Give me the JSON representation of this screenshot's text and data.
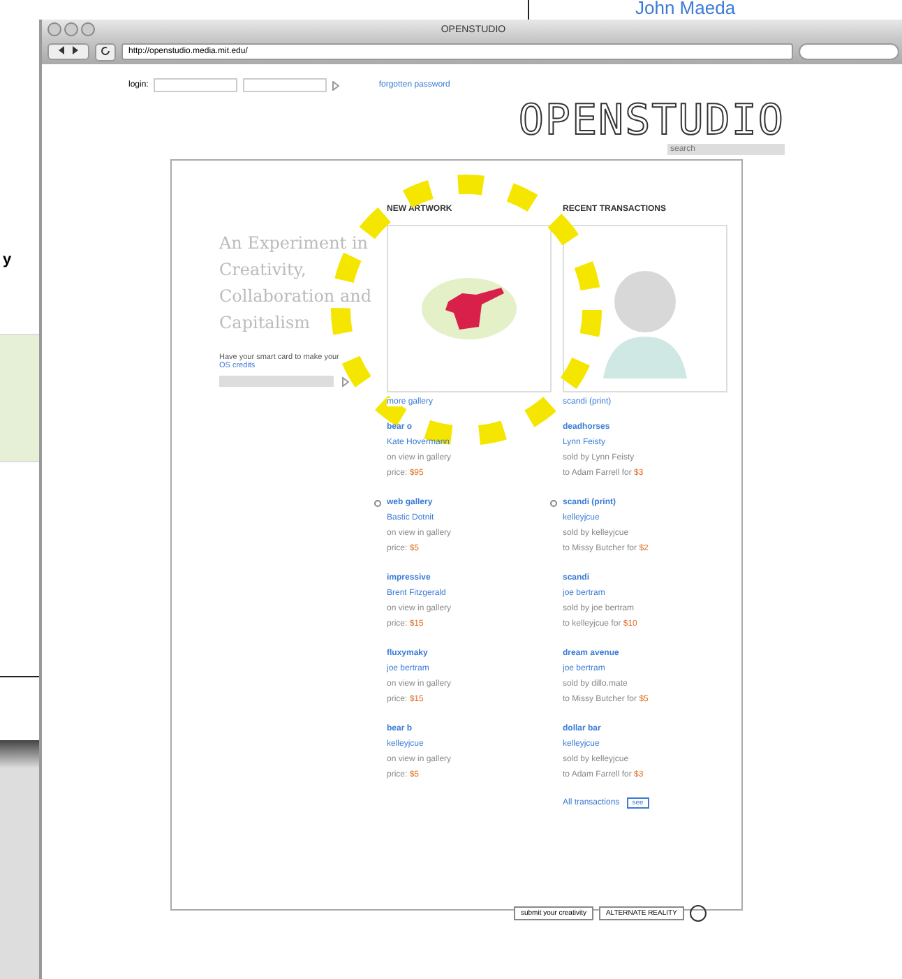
{
  "background_window": {
    "name": "John Maeda",
    "label": "y"
  },
  "window": {
    "title": "OPENSTUDIO"
  },
  "toolbar": {
    "url": "http://openstudio.media.mit.edu/"
  },
  "login": {
    "label": "login:",
    "link": "forgotten password"
  },
  "logo": "OPENSTUDIO",
  "search": {
    "placeholder": "search"
  },
  "intro": {
    "headline": "An Experiment in Creativity, Collaboration and Capitalism",
    "note": "Have your smart card to make your",
    "link": "OS credits"
  },
  "new_artwork": {
    "heading": "NEW ARTWORK",
    "caption": "more gallery",
    "items": [
      {
        "title": "bear o",
        "artist": "Kate Hovermann",
        "status": "on view in gallery",
        "price_label": "price:",
        "price": "$95",
        "flagged": false
      },
      {
        "title": "web gallery",
        "artist": "Bastic Dotnit",
        "status": "on view in gallery",
        "price_label": "price:",
        "price": "$5",
        "flagged": true
      },
      {
        "title": "impressive",
        "artist": "Brent Fitzgerald",
        "status": "on view in gallery",
        "price_label": "price:",
        "price": "$15",
        "flagged": false
      },
      {
        "title": "fluxymaky",
        "artist": "joe bertram",
        "status": "on view in gallery",
        "price_label": "price:",
        "price": "$15",
        "flagged": false
      },
      {
        "title": "bear b",
        "artist": "kelleyjcue",
        "status": "on view in gallery",
        "price_label": "price:",
        "price": "$5",
        "flagged": false
      }
    ]
  },
  "recent_transactions": {
    "heading": "RECENT TRANSACTIONS",
    "caption": "scandi (print)",
    "items": [
      {
        "title": "deadhorses",
        "artist": "Lynn Feisty",
        "seller": "sold by Lynn Feisty",
        "buyer": "to Adam Farrell for",
        "price": "$3",
        "flagged": false
      },
      {
        "title": "scandi (print)",
        "artist": "kelleyjcue",
        "seller": "sold by kelleyjcue",
        "buyer": "to Missy Butcher for",
        "price": "$2",
        "flagged": true
      },
      {
        "title": "scandi",
        "artist": "joe bertram",
        "seller": "sold by joe bertram",
        "buyer": "to kelleyjcue for",
        "price": "$10",
        "flagged": false
      },
      {
        "title": "dream avenue",
        "artist": "joe bertram",
        "seller": "sold by dillo.mate",
        "buyer": "to Missy Butcher for",
        "price": "$5",
        "flagged": false
      },
      {
        "title": "dollar bar",
        "artist": "kelleyjcue",
        "seller": "sold by kelleyjcue",
        "buyer": "to Adam Farrell for",
        "price": "$3",
        "flagged": false
      }
    ],
    "all_link": "All transactions",
    "see_button": "see"
  },
  "footer": {
    "buttons": [
      "submit your creativity",
      "ALTERNATE REALITY"
    ]
  }
}
